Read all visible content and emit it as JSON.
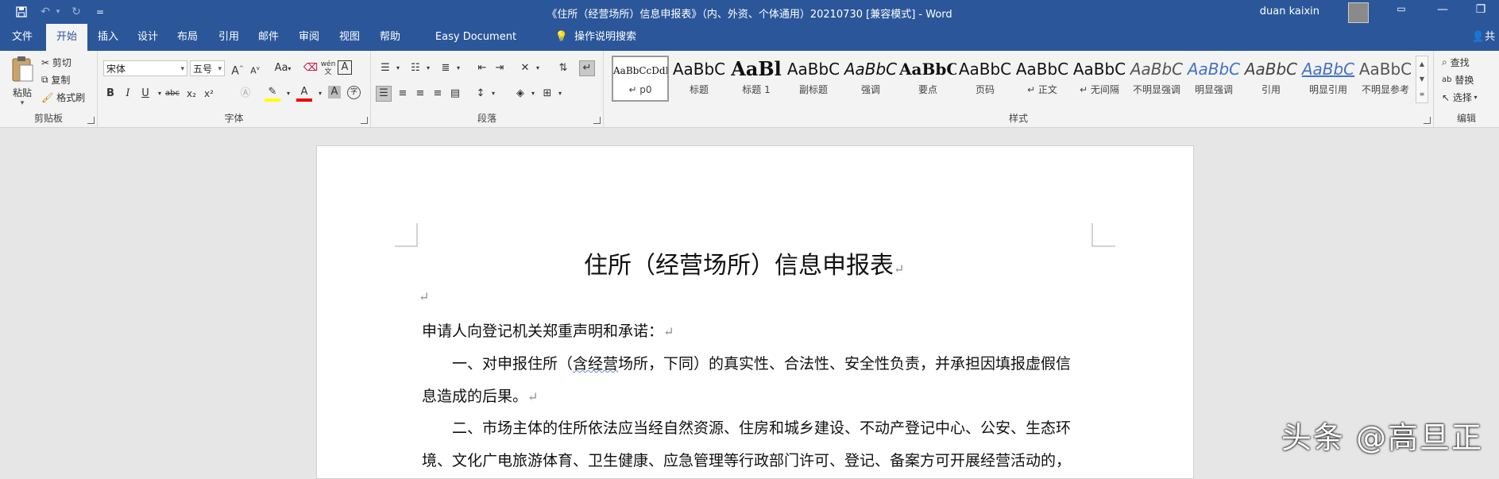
{
  "window": {
    "title": "《住所（经营场所）信息申报表》（内、外资、个体通用）20210730 [兼容模式]  -  Word",
    "user": "duan kaixin",
    "qat_extra": "="
  },
  "tabs": [
    "文件",
    "开始",
    "插入",
    "设计",
    "布局",
    "引用",
    "邮件",
    "审阅",
    "视图",
    "帮助",
    "Easy Document Creator",
    "操作说明搜索",
    "共享"
  ],
  "clipboard": {
    "paste": "粘贴",
    "cut": "剪切",
    "copy": "复制",
    "format_painter": "格式刷",
    "label": "剪贴板"
  },
  "font": {
    "name": "宋体",
    "size": "五号",
    "label": "字体",
    "phonetic": "wén",
    "change_case": "Aa",
    "bold": "B",
    "italic": "I",
    "underline": "U",
    "strike": "abc",
    "sub": "x₂",
    "sup": "x²",
    "grow": "A",
    "shrink": "A",
    "border_char": "A",
    "circle_char": "字"
  },
  "paragraph": {
    "label": "段落"
  },
  "styles": {
    "label": "样式",
    "items": [
      {
        "sample": "AaBbCcDdI",
        "name": "↵ p0"
      },
      {
        "sample": "AaBbC",
        "name": "标题"
      },
      {
        "sample": "AaBl",
        "name": "标题 1"
      },
      {
        "sample": "AaBbC",
        "name": "副标题"
      },
      {
        "sample": "AaBbC",
        "name": "强调"
      },
      {
        "sample": "AaBbC",
        "name": "要点"
      },
      {
        "sample": "AaBbC",
        "name": "页码"
      },
      {
        "sample": "AaBbC",
        "name": "↵ 正文"
      },
      {
        "sample": "AaBbC",
        "name": "↵ 无间隔"
      },
      {
        "sample": "AaBbC",
        "name": "不明显强调"
      },
      {
        "sample": "AaBbC",
        "name": "明显强调"
      },
      {
        "sample": "AaBbC",
        "name": "引用"
      },
      {
        "sample": "AaBbC",
        "name": "明显引用"
      },
      {
        "sample": "AaBbC",
        "name": "不明显参考"
      }
    ]
  },
  "editing": {
    "find": "查找",
    "replace": "替换",
    "select": "选择",
    "label": "编辑"
  },
  "document": {
    "title": "住所（经营场所）信息申报表",
    "para_mark": "↵",
    "lines": [
      "申请人向登记机关郑重声明和承诺：",
      "一、对申报住所（",
      "含经营",
      "场所，下同）的真实性、合法性、安全性负责，并承担因填报虚假信",
      "息造成的后果。",
      "二、市场主体的住所依法应当经自然资源、住房和城乡建设、不动产登记中心、公安、生态环",
      "境、文化广电旅游体育、卫生健康、应急管理等行政部门许可、登记、备案方可开展经营活动的，"
    ]
  },
  "watermark": "头条 @高旦正"
}
